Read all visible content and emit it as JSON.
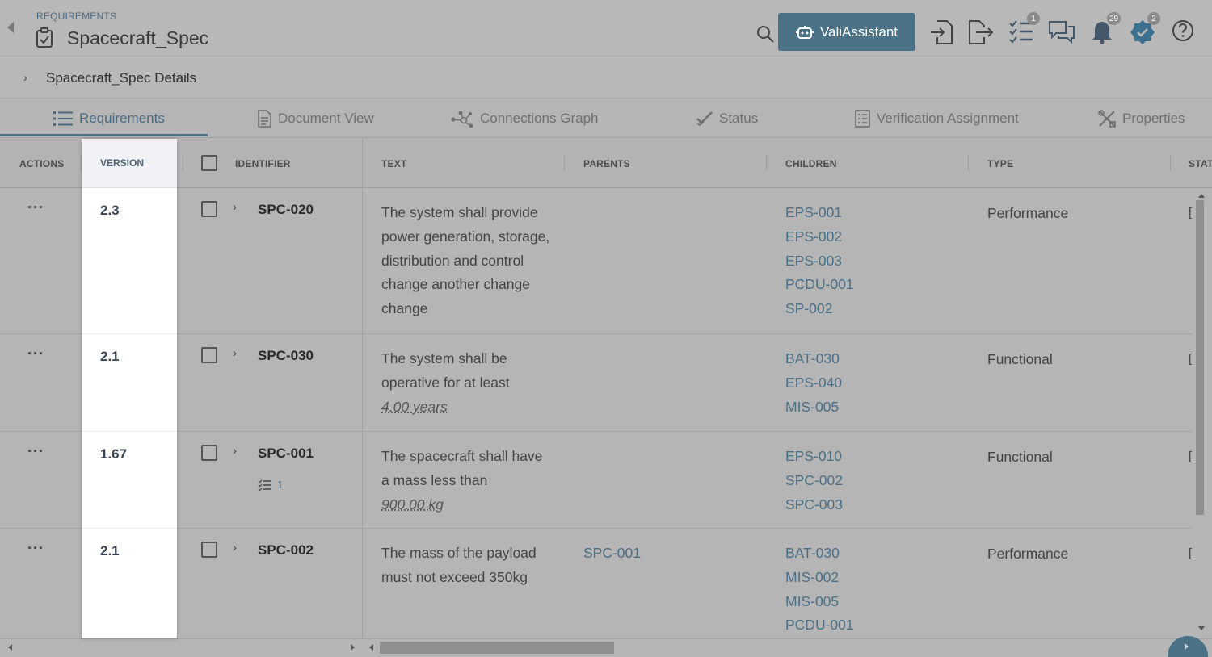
{
  "header": {
    "breadcrumb": "REQUIREMENTS",
    "title": "Spacecraft_Spec",
    "assistant_label": "ValiAssistant",
    "tasks_badge": "1",
    "notifications_badge": "29",
    "verified_badge": "2"
  },
  "details": {
    "label": "Spacecraft_Spec Details"
  },
  "tabs": [
    {
      "label": "Requirements",
      "icon": "list-icon"
    },
    {
      "label": "Document View",
      "icon": "document-icon"
    },
    {
      "label": "Connections Graph",
      "icon": "graph-icon"
    },
    {
      "label": "Status",
      "icon": "check-icon"
    },
    {
      "label": "Verification Assignment",
      "icon": "checklist-icon"
    },
    {
      "label": "Properties",
      "icon": "tools-icon"
    }
  ],
  "columns": {
    "actions": "ACTIONS",
    "version": "VERSION",
    "identifier": "IDENTIFIER",
    "text": "TEXT",
    "parents": "PARENTS",
    "children": "CHILDREN",
    "type": "TYPE",
    "status": "STAT"
  },
  "rows": [
    {
      "version": "2.3",
      "identifier": "SPC-020",
      "text_lines": [
        "The system shall provide",
        "power generation, storage,",
        "distribution and control",
        "change another change",
        "change"
      ],
      "parents": [],
      "children": [
        "EPS-001",
        "EPS-002",
        "EPS-003",
        "PCDU-001",
        "SP-002"
      ],
      "type": "Performance",
      "status_fragment": "["
    },
    {
      "version": "2.1",
      "identifier": "SPC-030",
      "text_lines": [
        "The system shall be",
        "operative for at least"
      ],
      "param": "4.00  years",
      "parents": [],
      "children": [
        "BAT-030",
        "EPS-040",
        "MIS-005"
      ],
      "type": "Functional",
      "status_fragment": "["
    },
    {
      "version": "1.67",
      "identifier": "SPC-001",
      "sub_count": "1",
      "text_lines": [
        "The spacecraft shall have",
        "a mass less than"
      ],
      "param": "900.00  kg",
      "parents": [],
      "children": [
        "EPS-010",
        "SPC-002",
        "SPC-003"
      ],
      "type": "Functional",
      "status_fragment": "["
    },
    {
      "version": "2.1",
      "identifier": "SPC-002",
      "text_lines": [
        "The mass of the payload",
        "must not exceed 350kg"
      ],
      "parents": [
        "SPC-001"
      ],
      "children": [
        "BAT-030",
        "MIS-002",
        "MIS-005",
        "PCDU-001"
      ],
      "type": "Performance",
      "status_fragment": "["
    }
  ],
  "colors": {
    "accent": "#4a7185",
    "link": "#4a6f87"
  }
}
